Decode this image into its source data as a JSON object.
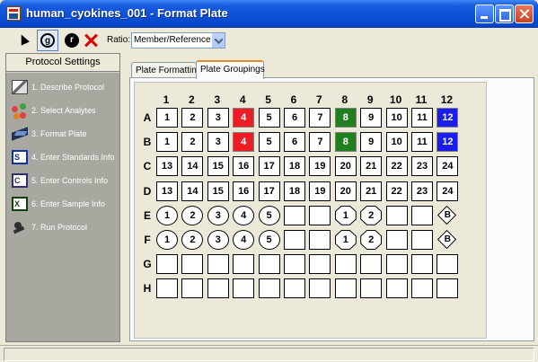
{
  "window": {
    "title": "human_cyokines_001 - Format Plate"
  },
  "toolbar": {
    "ratio_label": "Ratio:",
    "ratio_value": "Member/Reference",
    "group_glyph": "g",
    "ref_glyph": "r"
  },
  "left_panel": {
    "header": "Protocol Settings",
    "steps": [
      {
        "label": "1. Describe Protocol",
        "icon": "describe-protocol-icon"
      },
      {
        "label": "2. Select Analytes",
        "icon": "select-analytes-icon"
      },
      {
        "label": "3. Format Plate",
        "icon": "format-plate-icon"
      },
      {
        "label": "4. Enter Standards Info",
        "icon": "standards-icon",
        "glyph": "S"
      },
      {
        "label": "5. Enter Controls Info",
        "icon": "controls-icon",
        "glyph": "C"
      },
      {
        "label": "6. Enter Sample Info",
        "icon": "sample-icon",
        "glyph": "X"
      },
      {
        "label": "7. Run Protocol",
        "icon": "run-protocol-icon"
      }
    ]
  },
  "tabs": {
    "formatting": "Plate Formatting",
    "groupings": "Plate Groupings"
  },
  "plate": {
    "columns": [
      "1",
      "2",
      "3",
      "4",
      "5",
      "6",
      "7",
      "8",
      "9",
      "10",
      "11",
      "12"
    ],
    "rows": [
      "A",
      "B",
      "C",
      "D",
      "E",
      "F",
      "G",
      "H"
    ],
    "colors": {
      "red": "#ee1c24",
      "green": "#208020",
      "blue": "#1c1cee"
    },
    "wells": {
      "A": [
        {
          "t": "sq",
          "v": "1"
        },
        {
          "t": "sq",
          "v": "2"
        },
        {
          "t": "sq",
          "v": "3"
        },
        {
          "t": "sq",
          "v": "4",
          "c": "red"
        },
        {
          "t": "sq",
          "v": "5"
        },
        {
          "t": "sq",
          "v": "6"
        },
        {
          "t": "sq",
          "v": "7"
        },
        {
          "t": "sq",
          "v": "8",
          "c": "green"
        },
        {
          "t": "sq",
          "v": "9"
        },
        {
          "t": "sq",
          "v": "10"
        },
        {
          "t": "sq",
          "v": "11"
        },
        {
          "t": "sq",
          "v": "12",
          "c": "blue"
        }
      ],
      "B": [
        {
          "t": "sq",
          "v": "1"
        },
        {
          "t": "sq",
          "v": "2"
        },
        {
          "t": "sq",
          "v": "3"
        },
        {
          "t": "sq",
          "v": "4",
          "c": "red"
        },
        {
          "t": "sq",
          "v": "5"
        },
        {
          "t": "sq",
          "v": "6"
        },
        {
          "t": "sq",
          "v": "7"
        },
        {
          "t": "sq",
          "v": "8",
          "c": "green"
        },
        {
          "t": "sq",
          "v": "9"
        },
        {
          "t": "sq",
          "v": "10"
        },
        {
          "t": "sq",
          "v": "11"
        },
        {
          "t": "sq",
          "v": "12",
          "c": "blue"
        }
      ],
      "C": [
        {
          "t": "sq",
          "v": "13"
        },
        {
          "t": "sq",
          "v": "14"
        },
        {
          "t": "sq",
          "v": "15"
        },
        {
          "t": "sq",
          "v": "16"
        },
        {
          "t": "sq",
          "v": "17"
        },
        {
          "t": "sq",
          "v": "18"
        },
        {
          "t": "sq",
          "v": "19"
        },
        {
          "t": "sq",
          "v": "20"
        },
        {
          "t": "sq",
          "v": "21"
        },
        {
          "t": "sq",
          "v": "22"
        },
        {
          "t": "sq",
          "v": "23"
        },
        {
          "t": "sq",
          "v": "24"
        }
      ],
      "D": [
        {
          "t": "sq",
          "v": "13"
        },
        {
          "t": "sq",
          "v": "14"
        },
        {
          "t": "sq",
          "v": "15"
        },
        {
          "t": "sq",
          "v": "16"
        },
        {
          "t": "sq",
          "v": "17"
        },
        {
          "t": "sq",
          "v": "18"
        },
        {
          "t": "sq",
          "v": "19"
        },
        {
          "t": "sq",
          "v": "20"
        },
        {
          "t": "sq",
          "v": "21"
        },
        {
          "t": "sq",
          "v": "22"
        },
        {
          "t": "sq",
          "v": "23"
        },
        {
          "t": "sq",
          "v": "24"
        }
      ],
      "E": [
        {
          "t": "circle",
          "v": "1"
        },
        {
          "t": "circle",
          "v": "2"
        },
        {
          "t": "circle",
          "v": "3"
        },
        {
          "t": "circle",
          "v": "4"
        },
        {
          "t": "circle",
          "v": "5"
        },
        {
          "t": "empty",
          "v": ""
        },
        {
          "t": "empty",
          "v": ""
        },
        {
          "t": "oct",
          "v": "1"
        },
        {
          "t": "oct",
          "v": "2"
        },
        {
          "t": "empty",
          "v": ""
        },
        {
          "t": "empty",
          "v": ""
        },
        {
          "t": "dia",
          "v": "B"
        }
      ],
      "F": [
        {
          "t": "circle",
          "v": "1"
        },
        {
          "t": "circle",
          "v": "2"
        },
        {
          "t": "circle",
          "v": "3"
        },
        {
          "t": "circle",
          "v": "4"
        },
        {
          "t": "circle",
          "v": "5"
        },
        {
          "t": "empty",
          "v": ""
        },
        {
          "t": "empty",
          "v": ""
        },
        {
          "t": "oct",
          "v": "1"
        },
        {
          "t": "oct",
          "v": "2"
        },
        {
          "t": "empty",
          "v": ""
        },
        {
          "t": "empty",
          "v": ""
        },
        {
          "t": "dia",
          "v": "B"
        }
      ],
      "G": [
        {
          "t": "empty",
          "v": ""
        },
        {
          "t": "empty",
          "v": ""
        },
        {
          "t": "empty",
          "v": ""
        },
        {
          "t": "empty",
          "v": ""
        },
        {
          "t": "empty",
          "v": ""
        },
        {
          "t": "empty",
          "v": ""
        },
        {
          "t": "empty",
          "v": ""
        },
        {
          "t": "empty",
          "v": ""
        },
        {
          "t": "empty",
          "v": ""
        },
        {
          "t": "empty",
          "v": ""
        },
        {
          "t": "empty",
          "v": ""
        },
        {
          "t": "empty",
          "v": ""
        }
      ],
      "H": [
        {
          "t": "empty",
          "v": ""
        },
        {
          "t": "empty",
          "v": ""
        },
        {
          "t": "empty",
          "v": ""
        },
        {
          "t": "empty",
          "v": ""
        },
        {
          "t": "empty",
          "v": ""
        },
        {
          "t": "empty",
          "v": ""
        },
        {
          "t": "empty",
          "v": ""
        },
        {
          "t": "empty",
          "v": ""
        },
        {
          "t": "empty",
          "v": ""
        },
        {
          "t": "empty",
          "v": ""
        },
        {
          "t": "empty",
          "v": ""
        },
        {
          "t": "empty",
          "v": ""
        }
      ]
    }
  }
}
